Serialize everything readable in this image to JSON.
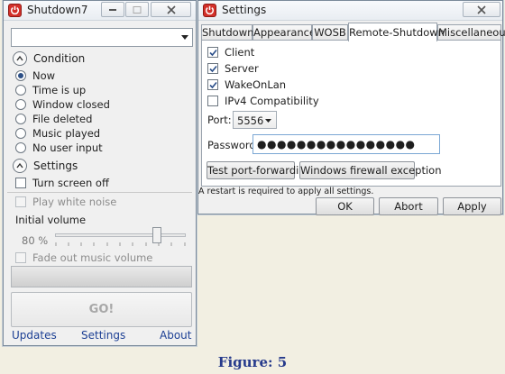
{
  "shutdown_window": {
    "title": "Shutdown7",
    "app_icon": "power-icon",
    "mode_select": {
      "value": ""
    },
    "condition": {
      "label": "Condition",
      "options": [
        "Now",
        "Time is up",
        "Window closed",
        "File deleted",
        "Music played",
        "No user input"
      ],
      "selected": "Now"
    },
    "settings": {
      "label": "Settings",
      "turn_screen_off": {
        "label": "Turn screen off",
        "checked": false
      },
      "play_white_noise": {
        "label": "Play white noise",
        "checked": false,
        "enabled": false
      },
      "initial_volume": {
        "label": "Initial volume",
        "value_text": "80 %",
        "value": 80
      },
      "fade_out": {
        "label": "Fade out music volume",
        "checked": false,
        "enabled": false
      }
    },
    "progress": 0,
    "go_label": "GO!",
    "links": {
      "updates": "Updates",
      "settings": "Settings",
      "about": "About"
    }
  },
  "settings_window": {
    "title": "Settings",
    "tabs": [
      "Shutdown",
      "Appearance",
      "WOSB",
      "Remote-Shutdown",
      "Miscellaneous"
    ],
    "active_tab": "Remote-Shutdown",
    "remote": {
      "client": {
        "label": "Client",
        "checked": true
      },
      "server": {
        "label": "Server",
        "checked": true
      },
      "wakeonlan": {
        "label": "WakeOnLan",
        "checked": true
      },
      "ipv4": {
        "label": "IPv4 Compatibility",
        "checked": false
      },
      "port_label": "Port:",
      "port_value": "5556",
      "password_label": "Password:",
      "password_value": "●●●●●●●●●●●●●●●●",
      "test_port_button": "Test port-forwarding",
      "firewall_button": "Windows firewall exception"
    },
    "restart_note": "A restart is required to apply all settings.",
    "buttons": {
      "ok": "OK",
      "abort": "Abort",
      "apply": "Apply"
    }
  },
  "caption": "Figure: 5",
  "colors": {
    "accent": "#d3302a",
    "link": "#1c3f94",
    "caption": "#273b8c"
  }
}
